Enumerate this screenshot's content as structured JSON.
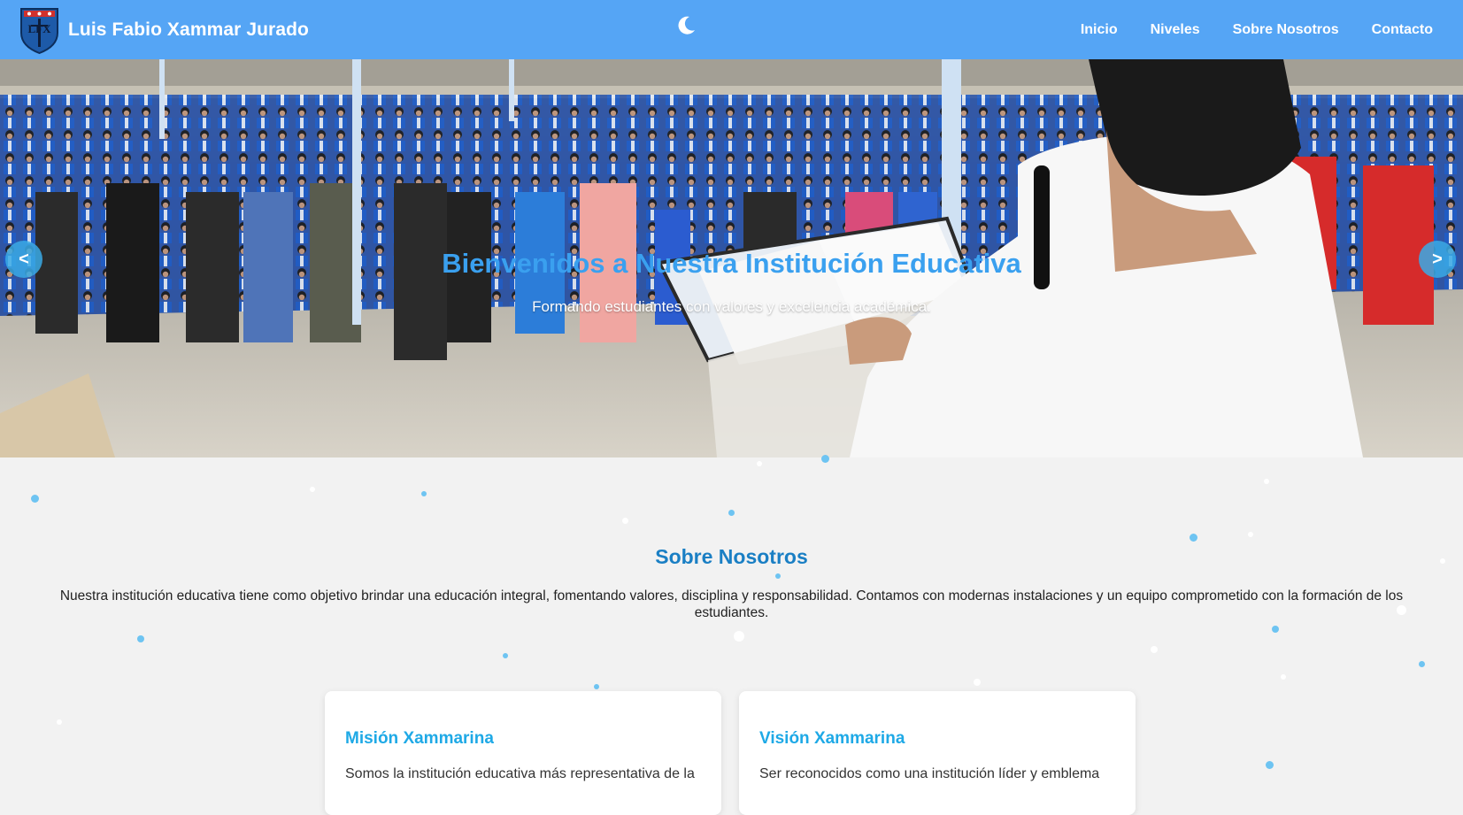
{
  "header": {
    "brand_name": "Luis Fabio Xammar Jurado",
    "logo_text": "LFX",
    "theme_toggle_icon": "moon-icon",
    "nav": [
      {
        "label": "Inicio"
      },
      {
        "label": "Niveles"
      },
      {
        "label": "Sobre Nosotros"
      },
      {
        "label": "Contacto"
      }
    ]
  },
  "hero": {
    "title": "Bienvenidos a Nuestra Institución Educativa",
    "subtitle": "Formando estudiantes con valores y excelencia académica.",
    "prev_label": "<",
    "next_label": ">"
  },
  "about": {
    "title": "Sobre Nosotros",
    "text": "Nuestra institución educativa tiene como objetivo brindar una educación integral, fomentando valores, disciplina y responsabilidad. Contamos con modernas instalaciones y un equipo comprometido con la formación de los estudiantes."
  },
  "cards": [
    {
      "title": "Misión Xammarina",
      "text": "Somos la institución educativa más representativa de la"
    },
    {
      "title": "Visión Xammarina",
      "text": "Ser reconocidos como una institución líder y emblema"
    }
  ],
  "colors": {
    "navbar": "#55a5f5",
    "accent": "#3aa0ef",
    "section_title": "#1a7fc4",
    "card_title": "#1ea9e6",
    "background": "#f2f2f2"
  }
}
